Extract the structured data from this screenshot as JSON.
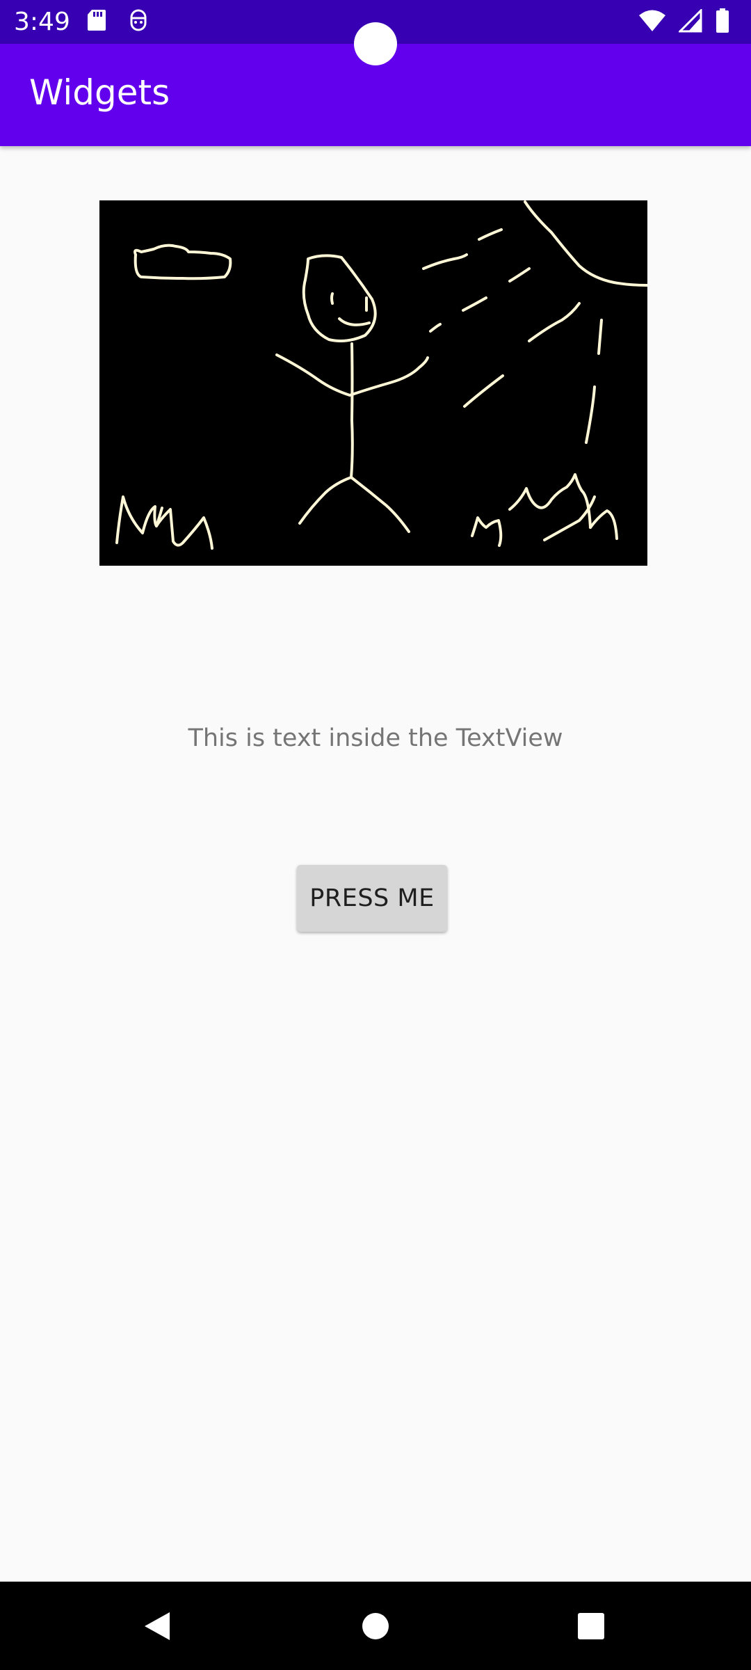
{
  "status_bar": {
    "time": "3:49",
    "icons_left": [
      "sd-card-icon",
      "privacy-indicator-icon"
    ],
    "icons_right": [
      "wifi-icon",
      "cell-signal-icon",
      "battery-icon"
    ],
    "background": "#3700b3"
  },
  "app_bar": {
    "title": "Widgets",
    "background": "#6200ee"
  },
  "main": {
    "image": {
      "description_icon": "stick-figure-drawing",
      "background": "#000000",
      "stroke_color": "#fff7d6"
    },
    "textview_text": "This is text inside the TextView",
    "button_label": "PRESS ME"
  },
  "nav_bar": {
    "items": [
      "back-icon",
      "home-icon",
      "recents-icon"
    ]
  }
}
